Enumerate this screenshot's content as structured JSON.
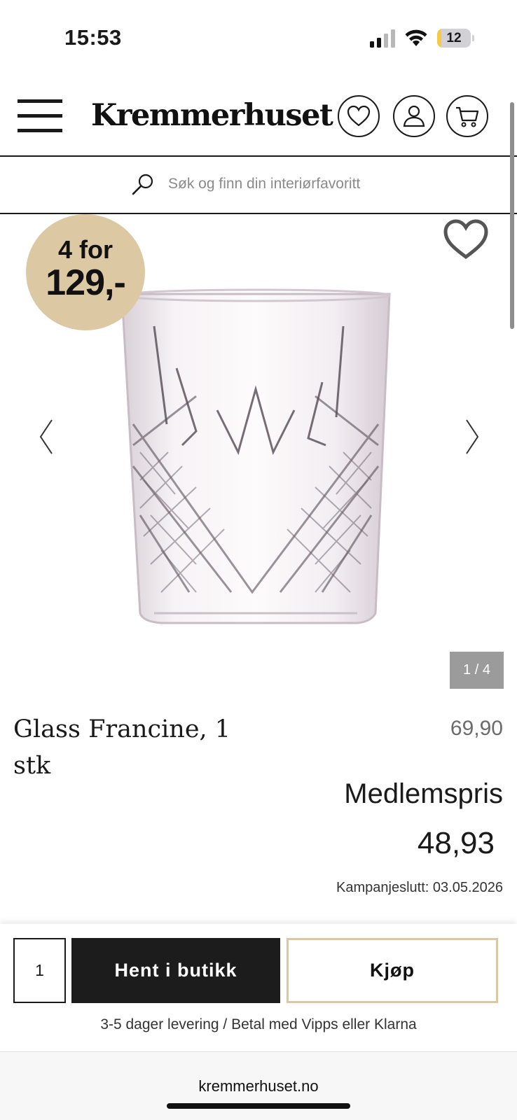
{
  "status": {
    "time": "15:53",
    "battery_level": "12",
    "battery_fraction": 0.12
  },
  "header": {
    "logo": "Kremmerhuset",
    "icons": [
      "menu-icon",
      "heart-icon",
      "user-icon",
      "cart-icon"
    ]
  },
  "search": {
    "placeholder": "Søk og finn din interiørfavoritt"
  },
  "gallery": {
    "promo_line1": "4 for",
    "promo_line2": "129,-",
    "counter": "1 / 4",
    "badge_color": "#dcc8a2"
  },
  "product": {
    "title": "Glass Francine, 1 stk",
    "regular_price": "69,90",
    "member_label": "Medlemspris",
    "member_price": "48,93",
    "campaign_end": "Kampanjeslutt: 03.05.2026"
  },
  "buy_bar": {
    "quantity": "1",
    "store_button": "Hent i butikk",
    "buy_button": "Kjøp",
    "delivery_info": "3-5 dager levering / Betal med Vipps eller Klarna"
  },
  "browser": {
    "url": "kremmerhuset.no"
  }
}
